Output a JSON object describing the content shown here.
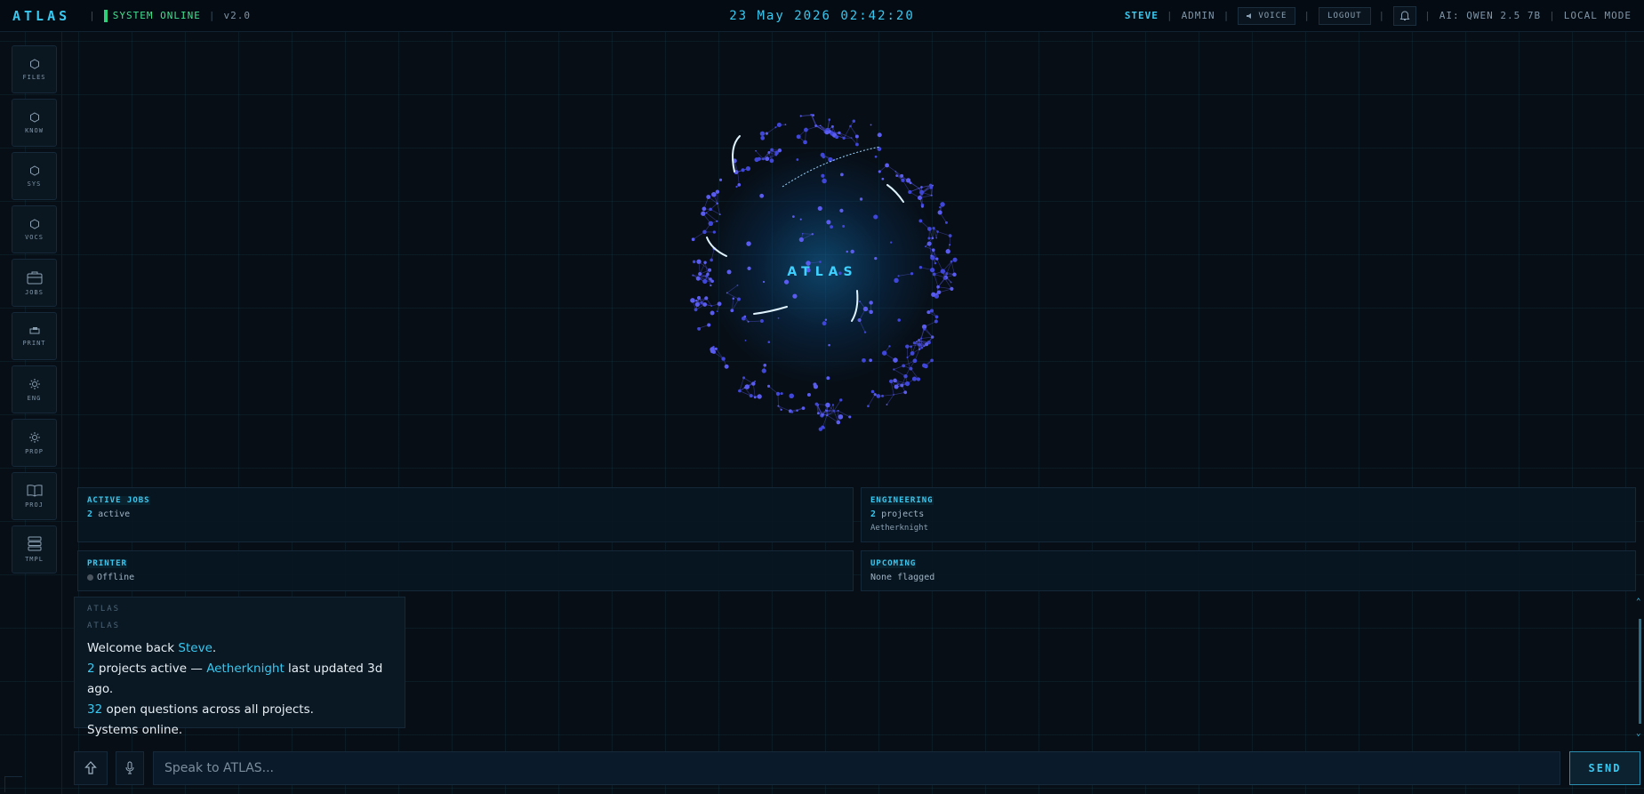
{
  "topbar": {
    "brand": "ATLAS",
    "status": "SYSTEM ONLINE",
    "version": "v2.0",
    "datetime": "23 May 2026 02:42:20",
    "user": "STEVE",
    "role": "ADMIN",
    "voice_label": "VOICE",
    "logout_label": "LOGOUT",
    "ai_model": "AI: QWEN 2.5 7B",
    "mode": "LOCAL MODE"
  },
  "sidebar": {
    "items": [
      {
        "label": "FILES",
        "icon": "hexagon-icon"
      },
      {
        "label": "KNOW",
        "icon": "hexagon-icon"
      },
      {
        "label": "SYS",
        "icon": "hexagon-icon"
      },
      {
        "label": "VOCS",
        "icon": "hexagon-icon"
      },
      {
        "label": "JOBS",
        "icon": "briefcase-icon"
      },
      {
        "label": "PRINT",
        "icon": "printer-icon"
      },
      {
        "label": "ENG",
        "icon": "gear-icon"
      },
      {
        "label": "PROP",
        "icon": "gear-icon"
      },
      {
        "label": "PROJ",
        "icon": "book-icon"
      },
      {
        "label": "TMPL",
        "icon": "layers-icon"
      }
    ]
  },
  "orb": {
    "label": "ATLAS"
  },
  "cards": {
    "active_jobs": {
      "title": "ACTIVE JOBS",
      "count": "2",
      "text": "active"
    },
    "engineering": {
      "title": "ENGINEERING",
      "count": "2",
      "text": "projects",
      "sub": "Aetherknight"
    },
    "printer": {
      "title": "PRINTER",
      "status": "Offline"
    },
    "upcoming": {
      "title": "UPCOMING",
      "text": "None flagged"
    }
  },
  "message": {
    "header1": "ATLAS",
    "header2": "ATLAS",
    "welcome_prefix": "Welcome back ",
    "welcome_name": "Steve",
    "welcome_suffix": ".",
    "projects_count": "2",
    "projects_mid": " projects active — ",
    "project_name": "Aetherknight",
    "projects_suffix": " last updated 3d ago.",
    "questions_count": "32",
    "questions_suffix": " open questions across all projects.",
    "systems": "Systems online."
  },
  "input": {
    "placeholder": "Speak to ATLAS...",
    "send_label": "SEND"
  },
  "colors": {
    "accent": "#38c8f0",
    "status_green": "#3ee08f",
    "background": "#070e16"
  }
}
